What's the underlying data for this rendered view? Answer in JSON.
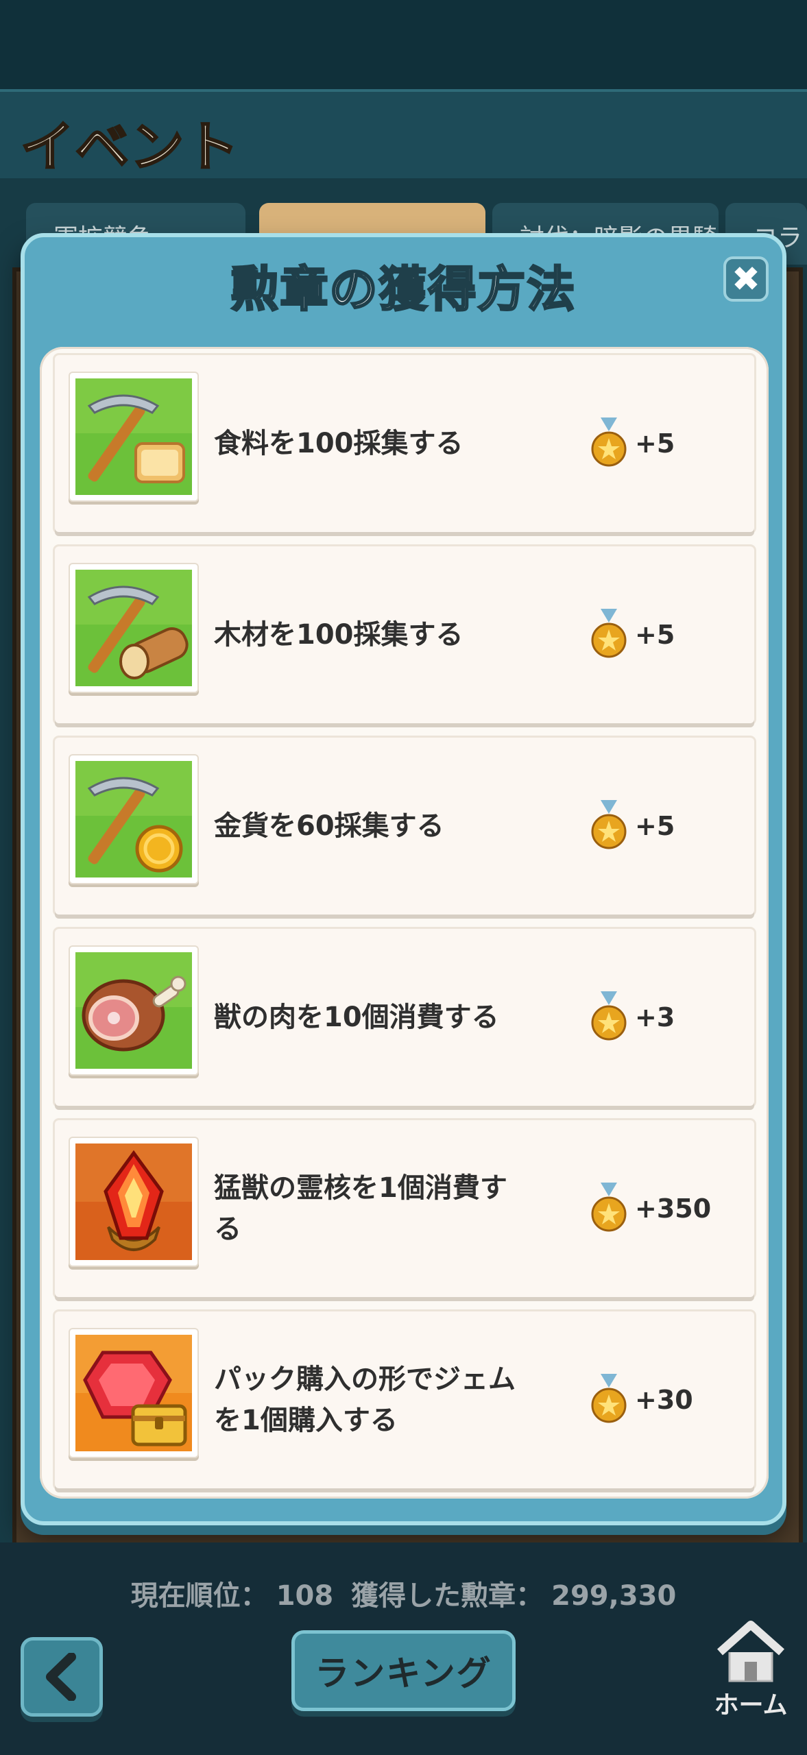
{
  "header": {
    "title": "イベント"
  },
  "bg_tabs": [
    {
      "label": "軍拡競争"
    },
    {
      "label": ""
    },
    {
      "label": "討伐：暗影の黒騎士"
    },
    {
      "label": "コラ"
    }
  ],
  "modal": {
    "title": "勲章の獲得方法",
    "close_label": "✖",
    "rows": [
      {
        "icon": "pickaxe-bread-icon",
        "text": "食料を100採集する",
        "reward": "+5"
      },
      {
        "icon": "pickaxe-wood-icon",
        "text": "木材を100採集する",
        "reward": "+5"
      },
      {
        "icon": "pickaxe-coin-icon",
        "text": "金貨を60採集する",
        "reward": "+5"
      },
      {
        "icon": "meat-icon",
        "text": "獣の肉を10個消費する",
        "reward": "+3"
      },
      {
        "icon": "beast-core-icon",
        "text": "猛獣の霊核を1個消費する",
        "reward": "+350"
      },
      {
        "icon": "gem-chest-icon",
        "text": "パック購入の形でジェムを1個購入する",
        "reward": "+30"
      }
    ]
  },
  "footer": {
    "rank_label": "現在順位：",
    "rank_value": "108",
    "medals_label": "獲得した勲章：",
    "medals_value": "299,330",
    "ranking_button": "ランキング",
    "home_label": "ホーム"
  }
}
